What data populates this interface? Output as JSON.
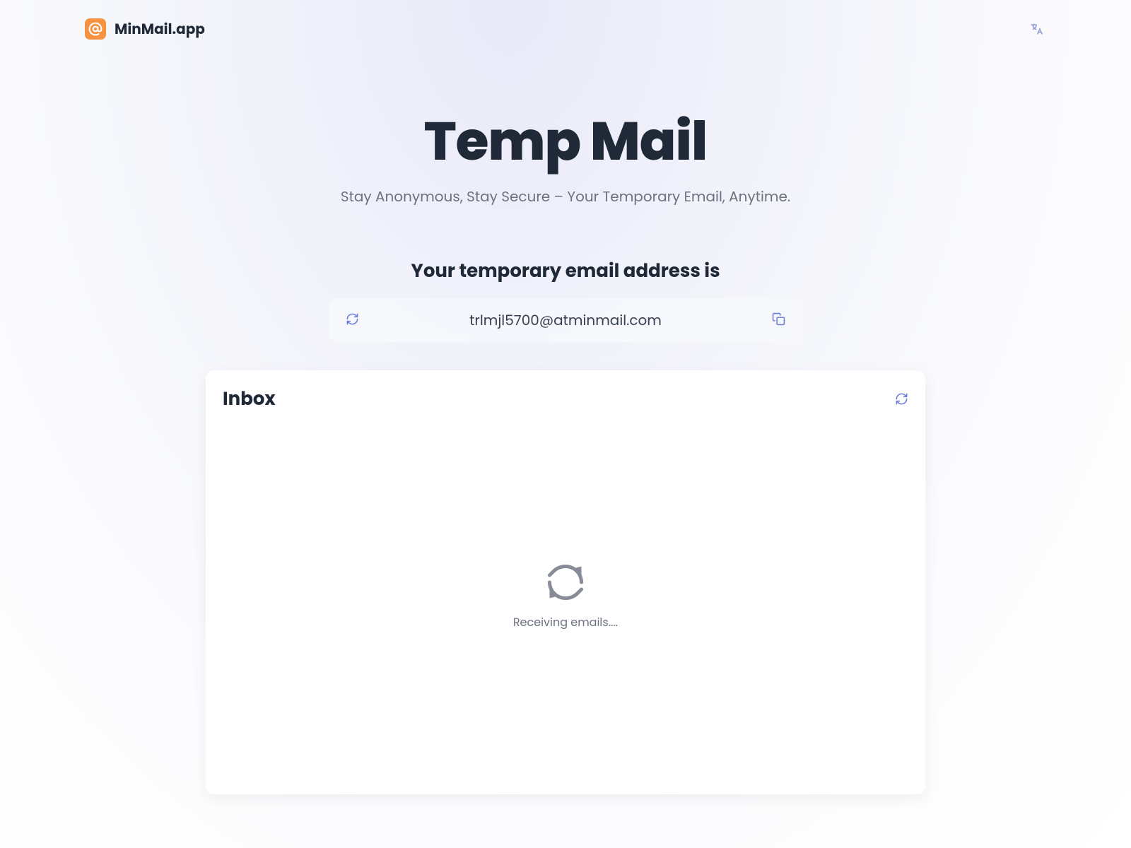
{
  "header": {
    "app_name": "MinMail.app"
  },
  "hero": {
    "title": "Temp Mail",
    "subtitle": "Stay Anonymous, Stay Secure – Your Temporary Email, Anytime."
  },
  "email": {
    "label": "Your temporary email address is",
    "address": "trlmjl5700@atminmail.com"
  },
  "inbox": {
    "title": "Inbox",
    "loading_text": "Receiving emails...."
  },
  "colors": {
    "brand": "#f59342",
    "accent": "#6b7dd8"
  }
}
